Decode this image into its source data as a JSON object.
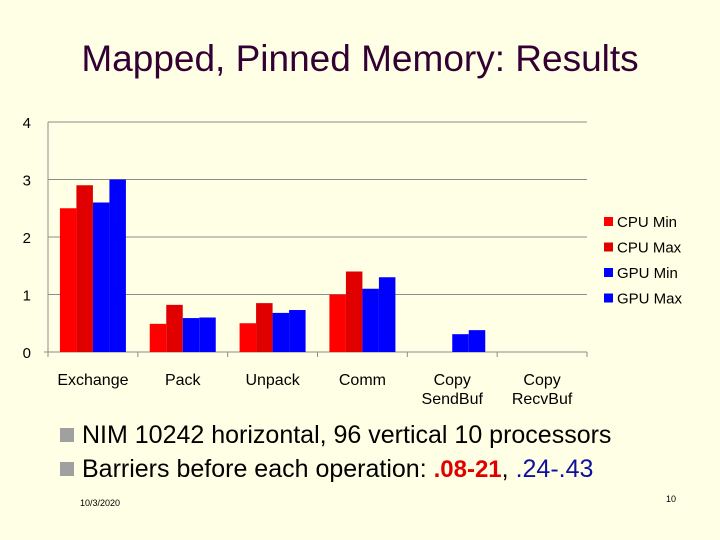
{
  "slide": {
    "title": "Mapped, Pinned Memory: Results",
    "bullets": [
      {
        "text": "NIM 10242 horizontal, 96 vertical 10 processors"
      },
      {
        "prefix": "Barriers before each operation: ",
        "highlight_red": ".08-21",
        "separator": ", ",
        "highlight_blue": ".24-.43"
      }
    ],
    "footer_date": "10/3/2020",
    "page_number": "10",
    "colors": {
      "background": "#FFFFE5",
      "title": "#330033",
      "cpu": "#FF0000",
      "gpu": "#0000FF",
      "bullet": "#A0A0A0"
    }
  },
  "chart_data": {
    "type": "bar",
    "title": "",
    "xlabel": "",
    "ylabel": "",
    "ylim": [
      0,
      4
    ],
    "yticks": [
      0,
      1,
      2,
      3,
      4
    ],
    "grid": true,
    "legend": "right",
    "categories": [
      [
        "Exchange"
      ],
      [
        "Pack"
      ],
      [
        "Unpack"
      ],
      [
        "Comm"
      ],
      [
        "Copy",
        "SendBuf"
      ],
      [
        "Copy",
        "RecvBuf"
      ]
    ],
    "series": [
      {
        "name": "CPU Min",
        "color": "#FF0000",
        "values": [
          2.5,
          0.49,
          0.5,
          1.0,
          0,
          0
        ]
      },
      {
        "name": "CPU Max",
        "color": "#E00000",
        "values": [
          2.9,
          0.82,
          0.85,
          1.4,
          0,
          0
        ]
      },
      {
        "name": "GPU Min",
        "color": "#0000FF",
        "values": [
          2.6,
          0.59,
          0.68,
          1.1,
          0.31,
          0
        ]
      },
      {
        "name": "GPU Max",
        "color": "#0000FF",
        "values": [
          3.0,
          0.6,
          0.73,
          1.3,
          0.38,
          0
        ]
      }
    ]
  }
}
